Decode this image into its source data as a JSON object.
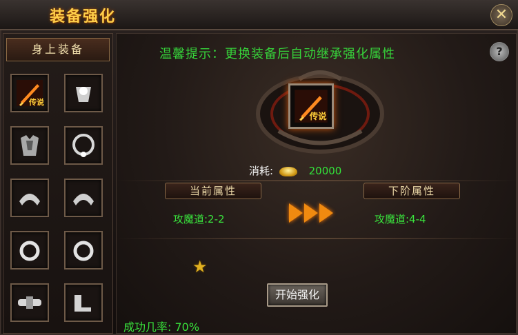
{
  "window": {
    "title": "装备强化",
    "close_icon": "close-x-icon"
  },
  "left_panel": {
    "header": "身上装备",
    "slots": [
      {
        "name": "weapon",
        "badge": "传说",
        "icon": "sword-icon"
      },
      {
        "name": "helmet",
        "badge": "",
        "icon": "armor-icon"
      },
      {
        "name": "armor",
        "badge": "",
        "icon": "chest-armor-icon"
      },
      {
        "name": "necklace",
        "badge": "",
        "icon": "necklace-icon"
      },
      {
        "name": "bracelet-left",
        "badge": "",
        "icon": "bracelet-icon"
      },
      {
        "name": "bracelet-right",
        "badge": "",
        "icon": "bracelet-icon"
      },
      {
        "name": "ring-left",
        "badge": "",
        "icon": "ring-icon"
      },
      {
        "name": "ring-right",
        "badge": "",
        "icon": "ring-icon"
      },
      {
        "name": "belt",
        "badge": "",
        "icon": "belt-icon"
      },
      {
        "name": "boots",
        "badge": "",
        "icon": "boots-icon"
      }
    ]
  },
  "main": {
    "tip": "温馨提示：更换装备后自动继承强化属性",
    "help_label": "?",
    "selected_item_badge": "传说",
    "cost_label": "消耗:",
    "cost_value": "20000",
    "current_label": "当前属性",
    "next_label": "下阶属性",
    "current_attr": "攻魔道:2-2",
    "next_attr": "攻魔道:4-4",
    "star_count": 1,
    "start_button": "开始强化",
    "success_rate": "成功几率: 70%"
  },
  "colors": {
    "green_text": "#36d33a",
    "gold_title": "#ffcf4a",
    "arrow_orange": "#f08a10"
  }
}
